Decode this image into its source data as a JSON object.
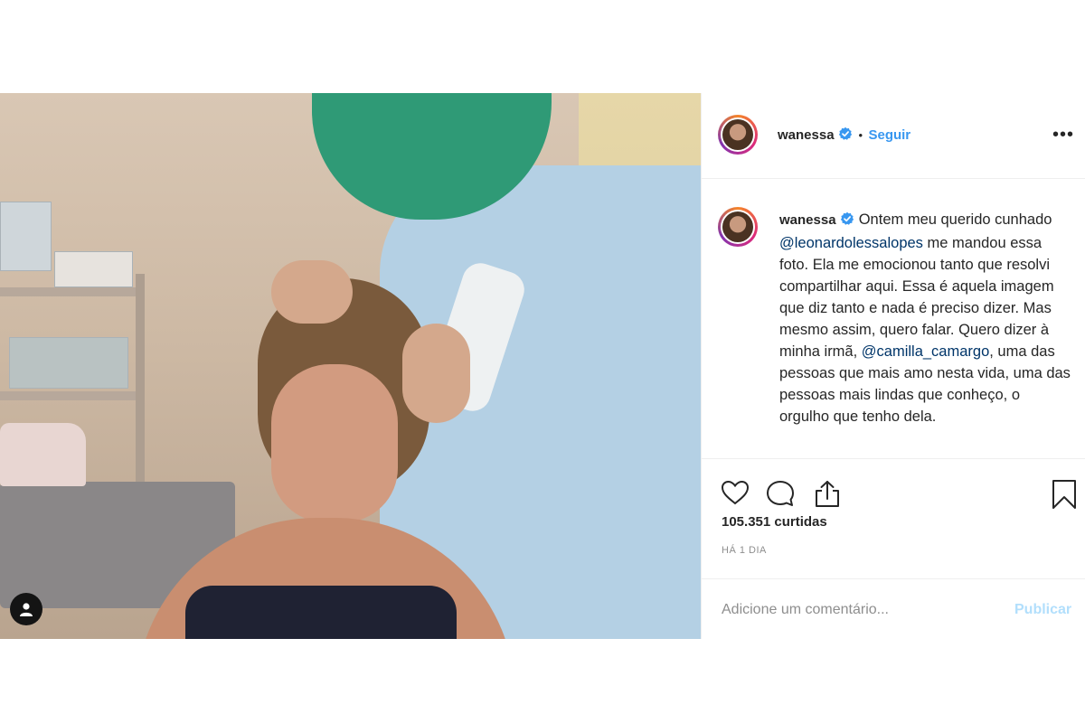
{
  "post": {
    "author": {
      "username": "wanessa",
      "verified": true,
      "separator": "•",
      "follow_label": "Seguir",
      "more_icon": "more-options-icon"
    },
    "caption": {
      "username": "wanessa",
      "text_1": " Ontem meu querido cunhado ",
      "mention_1": "@leonardolessalopes",
      "text_2": " me mandou essa foto. Ela me emocionou tanto que resolvi compartilhar aqui. Essa é aquela imagem que diz tanto e nada é preciso dizer. Mas mesmo assim, quero falar. Quero dizer à minha irmã, ",
      "mention_2": "@camilla_camargo",
      "text_3": ", uma das pessoas que mais amo nesta vida, uma das pessoas mais lindas que conheço, o orgulho que tenho dela."
    },
    "actions": {
      "like_icon": "heart-icon",
      "comment_icon": "comment-icon",
      "share_icon": "share-icon",
      "save_icon": "bookmark-icon"
    },
    "likes_text": "105.351 curtidas",
    "time_ago": "HÁ 1 DIA",
    "comment": {
      "placeholder": "Adicione um comentário...",
      "publish_label": "Publicar"
    },
    "photo": {
      "tag_icon": "user-tag-icon"
    }
  },
  "colors": {
    "link": "#3897f0",
    "mention": "#003569",
    "publish_disabled": "#b2dffc",
    "border": "#efefef"
  }
}
